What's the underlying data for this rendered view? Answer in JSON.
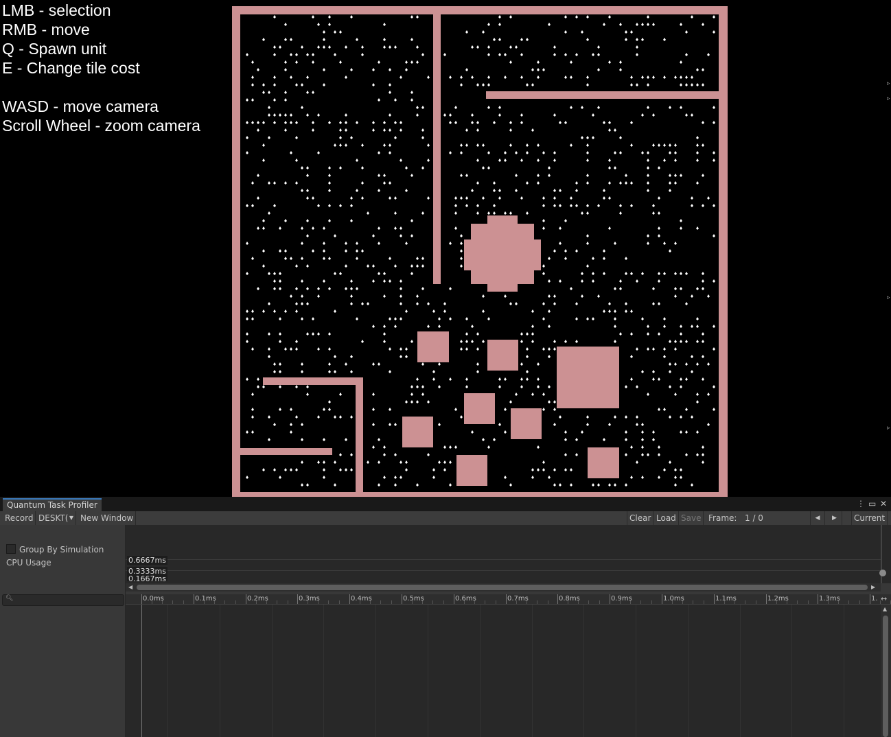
{
  "help": {
    "lines": [
      "LMB - selection",
      "RMB - move",
      "Q - Spawn unit",
      "E - Change tile cost",
      "",
      "WASD - move camera",
      "Scroll Wheel - zoom camera"
    ]
  },
  "colors": {
    "wall": "#cc9193",
    "game_bg": "#000000",
    "unit": "#ffffff",
    "panel_bg": "#383838",
    "accent": "#3a79bb"
  },
  "profiler": {
    "tab_title": "Quantum Task Profiler",
    "window_icons": [
      "more-icon",
      "maximize-icon",
      "close-icon"
    ],
    "toolbar": {
      "record": "Record",
      "target": "DESKT(",
      "new_window": "New Window",
      "clear": "Clear",
      "load": "Load",
      "save": "Save",
      "frame_label": "Frame:",
      "frame_value": "1 / 0",
      "current": "Current"
    },
    "group_by_simulation": "Group By Simulation",
    "group_by_checked": false,
    "cpu_usage": "CPU Usage",
    "graph_labels": [
      "0.6667ms",
      "0.3333ms",
      "0.1667ms"
    ],
    "ruler_labels": [
      "0.0ms",
      "0.1ms",
      "0.2ms",
      "0.3ms",
      "0.4ms",
      "0.5ms",
      "0.6ms",
      "0.7ms",
      "0.8ms",
      "0.9ms",
      "1.0ms",
      "1.1ms",
      "1.2ms",
      "1.3ms",
      "1."
    ]
  }
}
